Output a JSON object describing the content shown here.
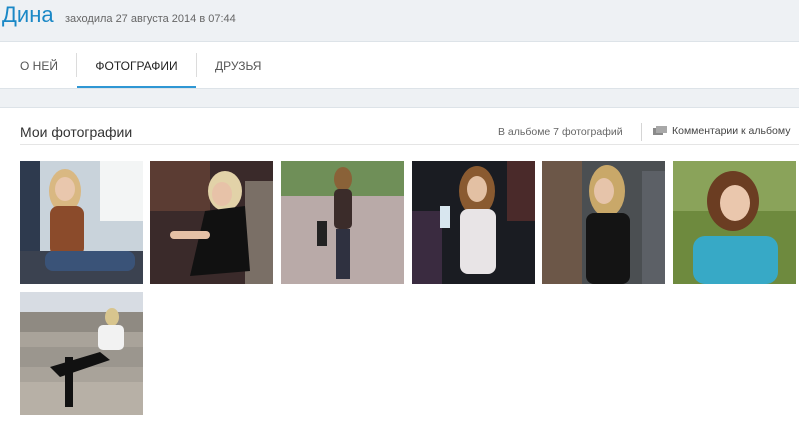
{
  "header": {
    "name": "Дина",
    "last_seen": "заходила 27 августа 2014 в 07:44"
  },
  "tabs": [
    {
      "label": "О НЕЙ"
    },
    {
      "label": "ФОТОГРАФИИ"
    },
    {
      "label": "ДРУЗЬЯ"
    }
  ],
  "photos_section": {
    "title": "Мои фотографии",
    "count_text": "В альбоме 7 фотографий",
    "comments_link": "Комментарии к альбому"
  },
  "colors": {
    "accent": "#1a88c6",
    "tab_underline": "#2f97d4"
  }
}
